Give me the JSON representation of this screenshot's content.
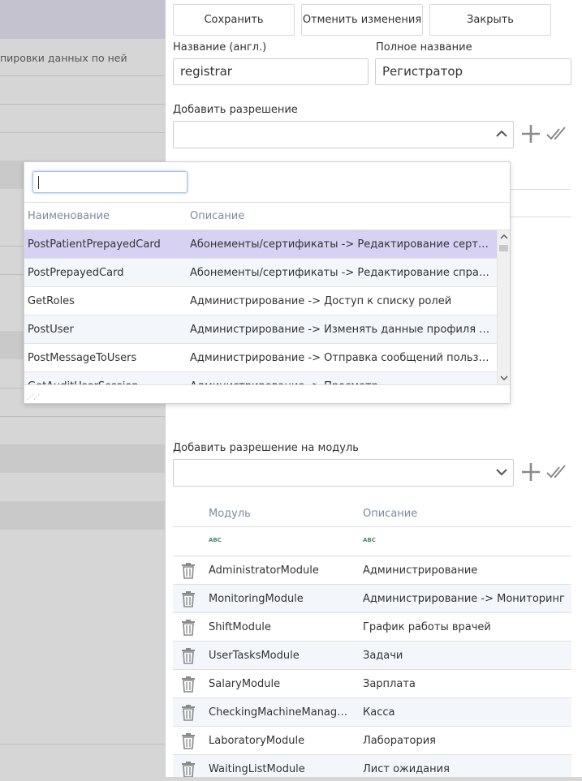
{
  "background": {
    "column_caption": "пировки данных по ней"
  },
  "toolbar": {
    "save_label": "Сохранить",
    "cancel_label": "Отменить изменения",
    "close_label": "Закрыть"
  },
  "form": {
    "name_en_label": "Название (англ.)",
    "name_en_value": "registrar",
    "full_name_label": "Полное название",
    "full_name_value": "Регистратор",
    "add_permission_label": "Добавить разрешение",
    "add_module_permission_label": "Добавить разрешение на модуль"
  },
  "permission_popup": {
    "search_value": "",
    "columns": {
      "name": "Наименование",
      "description": "Описание"
    },
    "rows": [
      {
        "name": "PostPatientPrepayedCard",
        "description": "Абонементы/сертификаты -> Редактирование сертификатов"
      },
      {
        "name": "PostPrepayedCard",
        "description": "Абонементы/сертификаты -> Редактирование справочника"
      },
      {
        "name": "GetRoles",
        "description": "Администрирование -> Доступ к списку ролей"
      },
      {
        "name": "PostUser",
        "description": "Администрирование -> Изменять данные профиля пользователя"
      },
      {
        "name": "PostMessageToUsers",
        "description": "Администрирование -> Отправка сообщений пользователям"
      },
      {
        "name": "GetAuditUserSession",
        "description": "Администрирование -> Просмотр"
      }
    ]
  },
  "modules_grid": {
    "columns": {
      "module": "Модуль",
      "description": "Описание"
    },
    "filter_icon_label": "ABC",
    "rows": [
      {
        "module": "AdministratorModule",
        "description": "Администрирование"
      },
      {
        "module": "MonitoringModule",
        "description": "Администрирование -> Мониторинг"
      },
      {
        "module": "ShiftModule",
        "description": "График работы врачей"
      },
      {
        "module": "UserTasksModule",
        "description": "Задачи"
      },
      {
        "module": "SalaryModule",
        "description": "Зарплата"
      },
      {
        "module": "CheckingMachineManagerModule",
        "description": "Касса"
      },
      {
        "module": "LaboratoryModule",
        "description": "Лаборатория"
      },
      {
        "module": "WaitingListModule",
        "description": "Лист ожидания"
      }
    ]
  },
  "colors": {
    "selected_row": "#d7d2f3",
    "alt_row": "#f3f6fa",
    "header_text": "#7b8ba3",
    "icon_gray": "#8a8a8a"
  }
}
